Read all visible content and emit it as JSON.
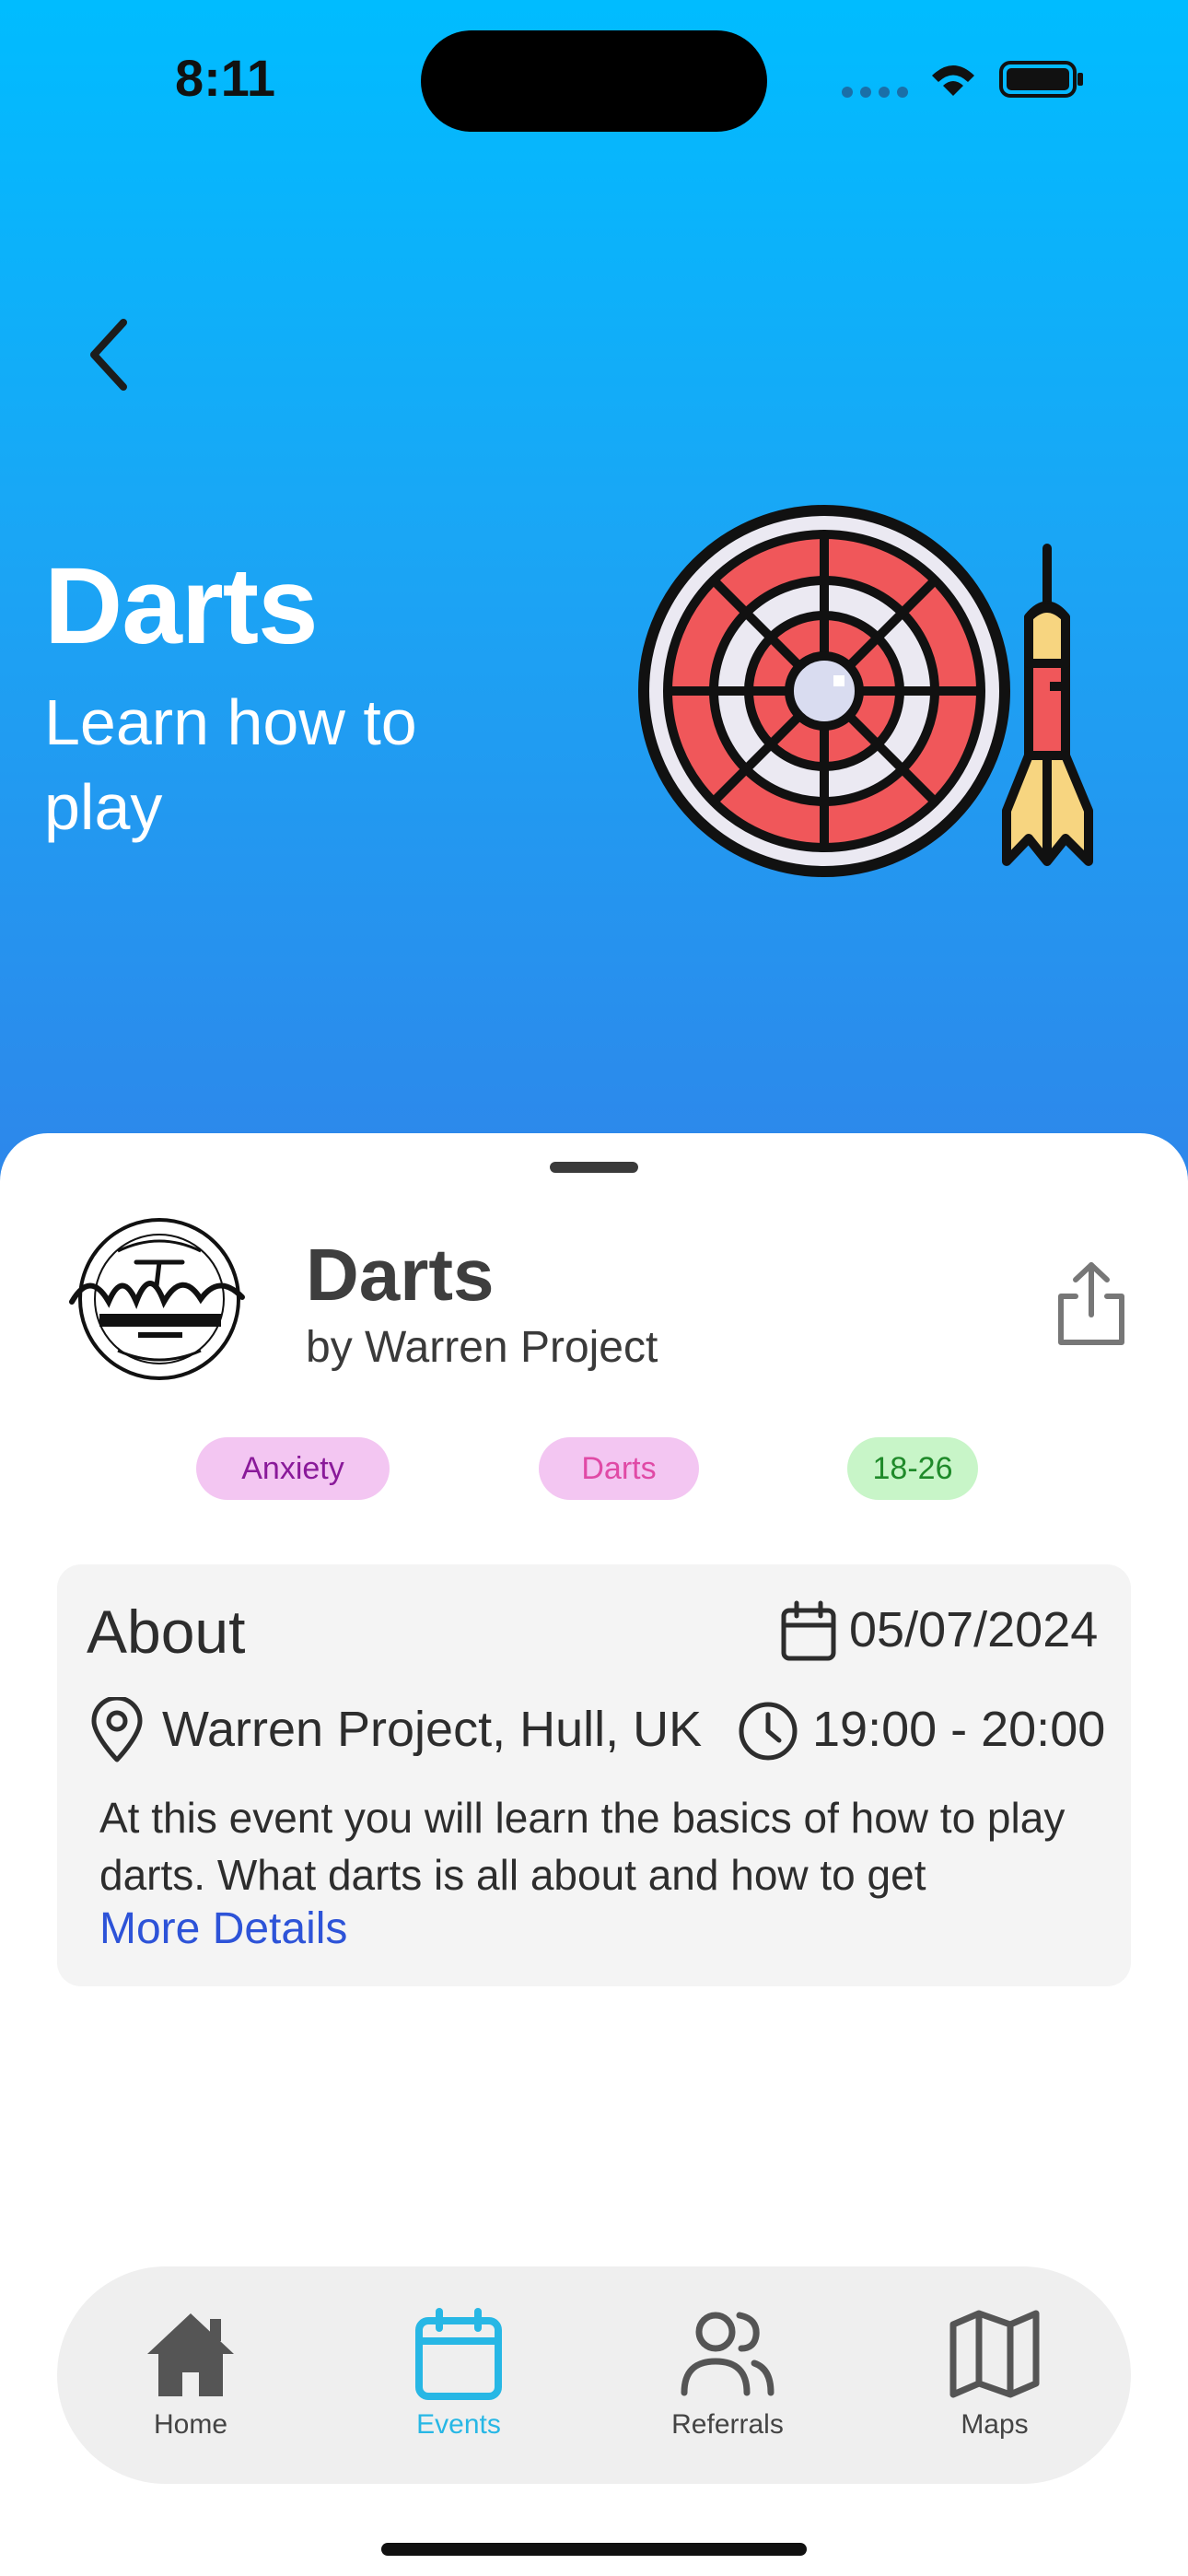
{
  "status_bar": {
    "time": "8:11"
  },
  "hero": {
    "title": "Darts",
    "subtitle": "Learn how to play"
  },
  "event": {
    "title": "Darts",
    "organizer": "by Warren Project",
    "logo_icon": "warren-youth-project-logo",
    "tags": [
      "Anxiety",
      "Darts",
      "18-26"
    ]
  },
  "about": {
    "title": "About",
    "date": "05/07/2024",
    "location": "Warren Project, Hull, UK",
    "time": "19:00 - 20:00",
    "description": "At this event you will learn the basics of how to play darts. What darts is all about and how to get",
    "more_link": "More Details"
  },
  "tab_bar": {
    "items": [
      {
        "label": "Home",
        "icon": "home-icon"
      },
      {
        "label": "Events",
        "icon": "calendar-icon",
        "active": true
      },
      {
        "label": "Referrals",
        "icon": "users-icon"
      },
      {
        "label": "Maps",
        "icon": "map-icon"
      }
    ]
  },
  "colors": {
    "hero_top": "#00bcff",
    "hero_bottom": "#2e86ea",
    "accent_active": "#27b7e5",
    "link": "#2d53d8",
    "tag_pink_bg": "#f3c6f2",
    "tag_green_bg": "#c8f5c8"
  }
}
